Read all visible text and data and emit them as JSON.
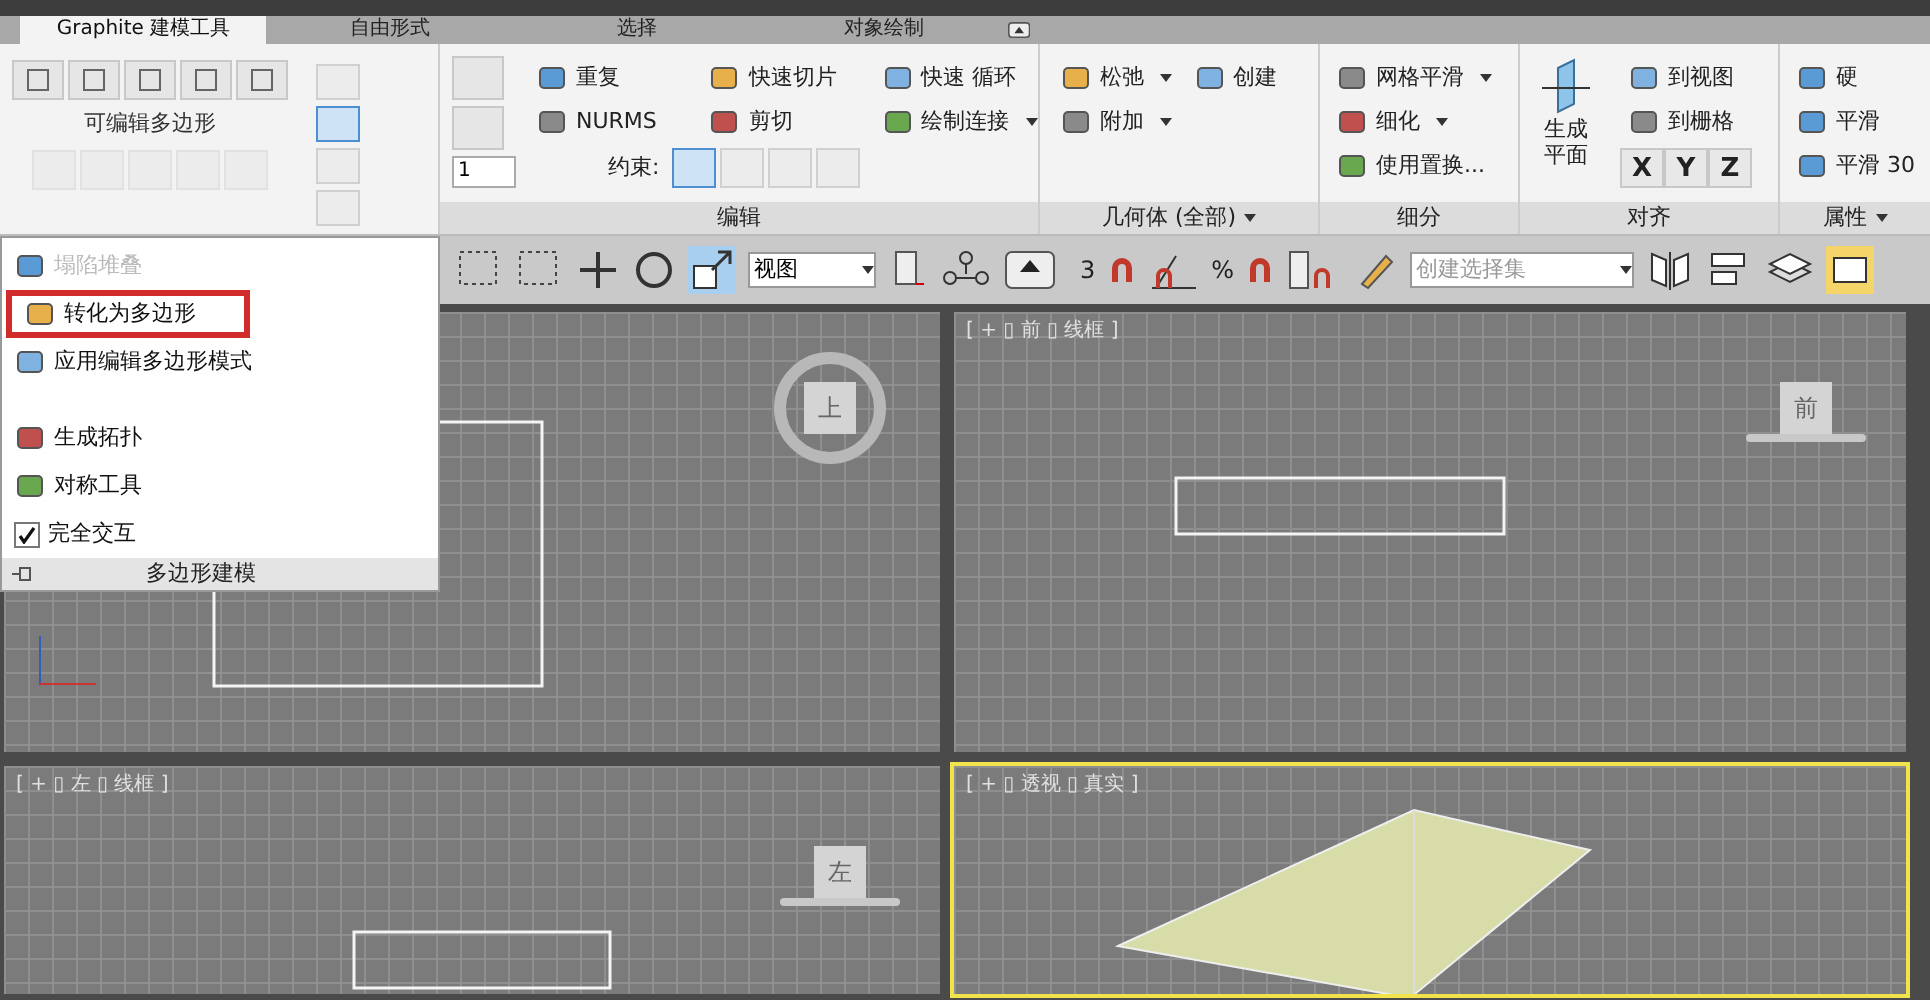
{
  "tabs": [
    {
      "label": "Graphite 建模工具",
      "selected": true
    },
    {
      "label": "自由形式",
      "selected": false
    },
    {
      "label": "选择",
      "selected": false
    },
    {
      "label": "对象绘制",
      "selected": false
    }
  ],
  "ribbon": {
    "polygon_panel": {
      "label": "可编辑多边形",
      "side_buttons": [
        {
          "selected": false
        },
        {
          "selected": true
        },
        {
          "selected": false
        },
        {
          "selected": false
        }
      ]
    },
    "edit": {
      "title": "编辑",
      "spinner": "1",
      "items": [
        {
          "label": "重复",
          "menu": false
        },
        {
          "label": "快速切片",
          "menu": false
        },
        {
          "label": "快速 循环",
          "menu": false
        },
        {
          "label": "NURMS",
          "menu": false
        },
        {
          "label": "剪切",
          "menu": false
        },
        {
          "label": "绘制连接",
          "menu": true
        }
      ],
      "constraint_label": "约束:",
      "constraints": [
        {
          "selected": true
        },
        {
          "selected": false
        },
        {
          "selected": false
        },
        {
          "selected": false
        }
      ]
    },
    "geometry": {
      "title": "几何体 (全部)",
      "items": [
        {
          "label": "松弛",
          "menu": true
        },
        {
          "label": "创建",
          "menu": false
        },
        {
          "label": "附加",
          "menu": true
        }
      ]
    },
    "subdivision": {
      "title": "细分",
      "items": [
        {
          "label": "网格平滑",
          "menu": true
        },
        {
          "label": "细化",
          "menu": true
        },
        {
          "label": "使用置换...",
          "menu": false
        }
      ]
    },
    "align": {
      "title": "对齐",
      "plane_button": "生成平面",
      "items": [
        {
          "label": "到视图"
        },
        {
          "label": "到栅格"
        }
      ],
      "axes": [
        "X",
        "Y",
        "Z"
      ]
    },
    "properties": {
      "title": "属性",
      "items": [
        {
          "label": "硬"
        },
        {
          "label": "平滑"
        },
        {
          "label": "平滑 30"
        }
      ]
    }
  },
  "toolbar": {
    "scale_selected": true,
    "view_dropdown": "视图",
    "snap_angle": "3",
    "snap_percent": "%",
    "selection_set": {
      "placeholder": "创建选择集"
    }
  },
  "menu": {
    "items": [
      {
        "kind": "action",
        "label": "塌陷堆叠",
        "disabled": true,
        "highlighted": false
      },
      {
        "kind": "action",
        "label": "转化为多边形",
        "disabled": false,
        "highlighted": true
      },
      {
        "kind": "action",
        "label": "应用编辑多边形模式",
        "disabled": false,
        "highlighted": false
      },
      {
        "kind": "gap"
      },
      {
        "kind": "action",
        "label": "生成拓扑",
        "disabled": false,
        "highlighted": false
      },
      {
        "kind": "action",
        "label": "对称工具",
        "disabled": false,
        "highlighted": false
      },
      {
        "kind": "check",
        "label": "完全交互",
        "checked": true
      }
    ],
    "footer": "多边形建模"
  },
  "viewports": [
    {
      "cube": "上",
      "active": false
    },
    {
      "label": "[ + ▯ 前 ▯ 线框 ]",
      "cube": "前",
      "active": false
    },
    {
      "label": "[ + ▯ 左 ▯ 线框 ]",
      "cube": "左",
      "active": false
    },
    {
      "label": "[ + ▯ 透视 ▯ 真实 ]",
      "active": true
    }
  ]
}
